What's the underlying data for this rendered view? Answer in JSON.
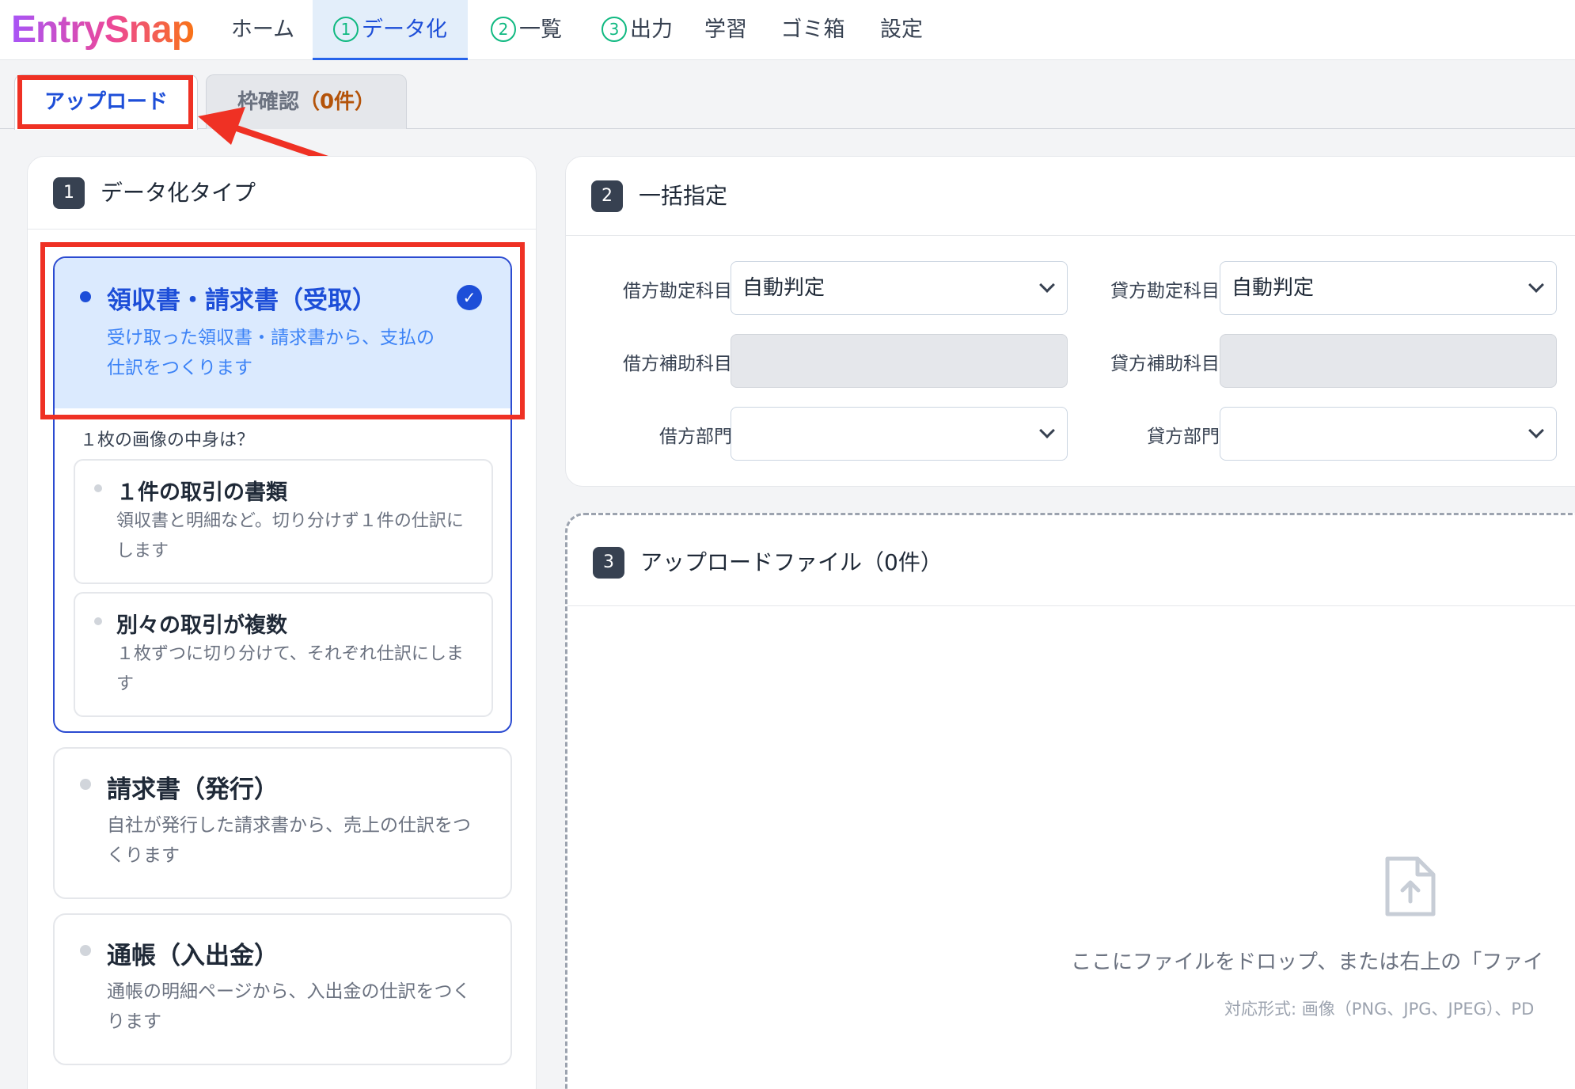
{
  "brand": {
    "logo": "EntrySnap"
  },
  "nav": {
    "home": "ホーム",
    "step1_num": "1",
    "step1_label": "データ化",
    "step2_num": "2",
    "step2_label": "一覧",
    "step3_num": "3",
    "step3_label": "出力",
    "learn": "学習",
    "trash": "ゴミ箱",
    "settings": "設定"
  },
  "subtabs": {
    "upload": "アップロード",
    "frame_label": "枠確認",
    "frame_count": "（0件）"
  },
  "type_panel": {
    "num": "1",
    "title": "データ化タイプ",
    "cards": [
      {
        "title": "領収書・請求書（受取）",
        "desc": "受け取った領収書・請求書から、支払の仕訳をつくります",
        "selected": true
      },
      {
        "title": "請求書（発行）",
        "desc": "自社が発行した請求書から、売上の仕訳をつくります",
        "selected": false
      },
      {
        "title": "通帳（入出金）",
        "desc": "通帳の明細ページから、入出金の仕訳をつくります",
        "selected": false
      }
    ],
    "question": "１枚の画像の中身は？",
    "options": [
      {
        "title": "１件の取引の書類",
        "desc": "領収書と明細など。切り分けず１件の仕訳にします"
      },
      {
        "title": "別々の取引が複数",
        "desc": "１枚ずつに切り分けて、それぞれ仕訳にします"
      }
    ]
  },
  "bulk_panel": {
    "num": "2",
    "title": "一括指定",
    "debit_account_label": "借方勘定科目",
    "debit_account_value": "自動判定",
    "credit_account_label": "貸方勘定科目",
    "credit_account_value": "自動判定",
    "debit_sub_label": "借方補助科目",
    "credit_sub_label": "貸方補助科目",
    "debit_dept_label": "借方部門",
    "credit_dept_label": "貸方部門"
  },
  "upload_panel": {
    "num": "3",
    "title": "アップロードファイル（0件）",
    "drop_text": "ここにファイルをドロップ、または右上の「ファイ",
    "formats": "対応形式: 画像（PNG、JPG、JPEG）、PD"
  }
}
